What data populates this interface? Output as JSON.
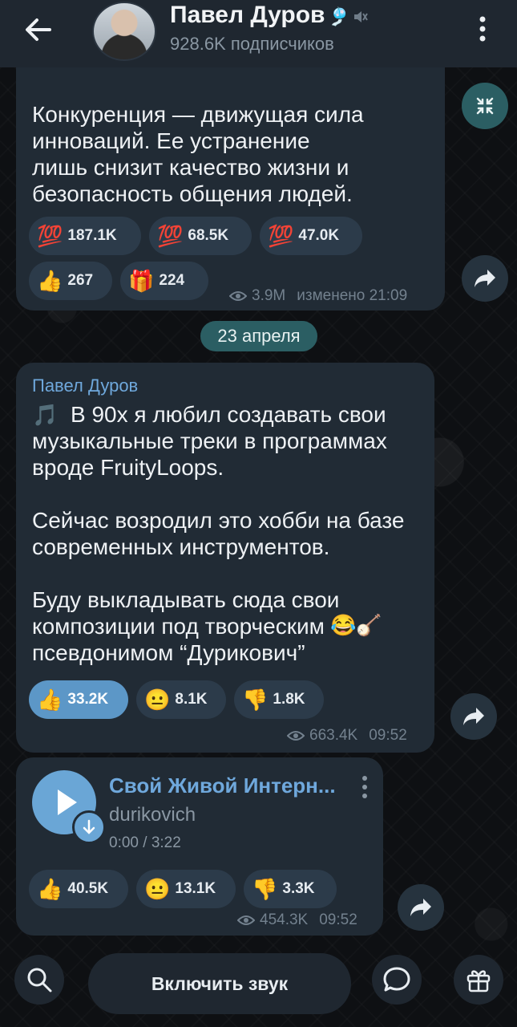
{
  "header": {
    "title": "Павел Дуров",
    "title_emoji": "🎐",
    "subscribers": "928.6K подписчиков"
  },
  "post1": {
    "text": "Конкуренция — движущая сила\nинноваций. Ее устранение\nлишь снизит качество жизни и\nбезопасность общения людей.",
    "reactions": [
      {
        "emoji": "💯",
        "count": "187.1K"
      },
      {
        "emoji": "💯",
        "count": "68.5K"
      },
      {
        "emoji": "💯",
        "count": "47.0K"
      },
      {
        "emoji": "👍",
        "count": "267"
      },
      {
        "emoji": "🎁",
        "count": "224"
      }
    ],
    "views": "3.9M",
    "edited": "изменено 21:09"
  },
  "date_separator": "23 апреля",
  "post2": {
    "author": "Павел Дуров",
    "text_lead": "🎵",
    "text": "В 90х я любил создавать свои\nмузыкальные треки в программах\nвроде FruityLoops.\n\nСейчас возродил это хобби на базе\nсовременных инструментов.\n\nБуду выкладывать сюда свои\nкомпозиции под творческим\nпсевдонимом “Дурикович”",
    "text_trail": "😂🪕",
    "reactions": [
      {
        "emoji": "👍",
        "count": "33.2K",
        "active": true
      },
      {
        "emoji": "😐",
        "count": "8.1K"
      },
      {
        "emoji": "👎",
        "count": "1.8K"
      }
    ],
    "views": "663.4K",
    "time": "09:52"
  },
  "post3": {
    "track_title": "Свой Живой Интерн...",
    "performer": "durikovich",
    "duration": "0:00 / 3:22",
    "reactions": [
      {
        "emoji": "👍",
        "count": "40.5K"
      },
      {
        "emoji": "😐",
        "count": "13.1K"
      },
      {
        "emoji": "👎",
        "count": "3.3K"
      }
    ],
    "views": "454.3K",
    "time": "09:52"
  },
  "bottom": {
    "unmute_label": "Включить звук"
  },
  "colors": {
    "accent": "#5c97c7",
    "bubble": "#212b35",
    "reaction_bg": "#2c3b4a",
    "date_pill": "#2b5e63"
  }
}
